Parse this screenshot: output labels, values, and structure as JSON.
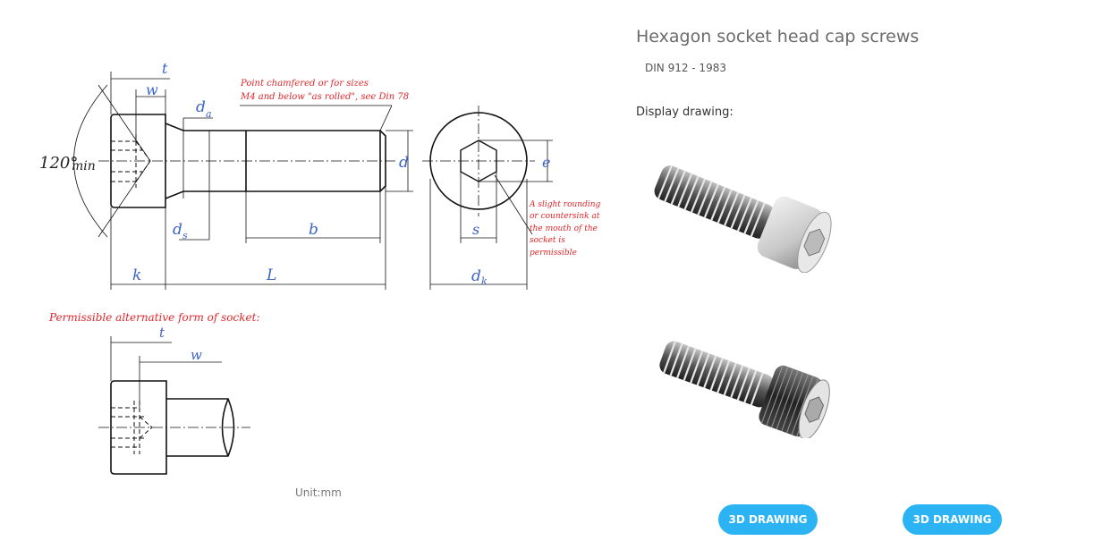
{
  "product": {
    "title": "Hexagon socket head cap screws",
    "standard": "DIN 912 - 1983",
    "display_label": "Display drawing:",
    "unit": "Unit:mm"
  },
  "buttons": [
    {
      "label": "3D DRAWING"
    },
    {
      "label": "3D DRAWING"
    }
  ],
  "drawing_labels": {
    "t": "t",
    "w": "w",
    "da": "d",
    "da_sub": "a",
    "angle": "120°",
    "angle_suffix": "min",
    "d": "d",
    "e": "e",
    "ds": "d",
    "ds_sub": "s",
    "b": "b",
    "s": "s",
    "k": "k",
    "L": "L",
    "dk": "d",
    "dk_sub": "k",
    "note_chamfer_1": "Point chamfered or for sizes",
    "note_chamfer_2": "M4 and below \"as rolled\", see Din 78",
    "note_round_1": "A slight rounding",
    "note_round_2": "or countersink at",
    "note_round_3": "the mouth of the",
    "note_round_4": "socket is",
    "note_round_5": "permissible",
    "alt_title": "Permissible alternative form of socket:",
    "alt_t": "t",
    "alt_w": "w"
  },
  "colors": {
    "button": "#2cb3f4",
    "dimension_text": "#3b64c8",
    "note_text": "#e0262a"
  }
}
